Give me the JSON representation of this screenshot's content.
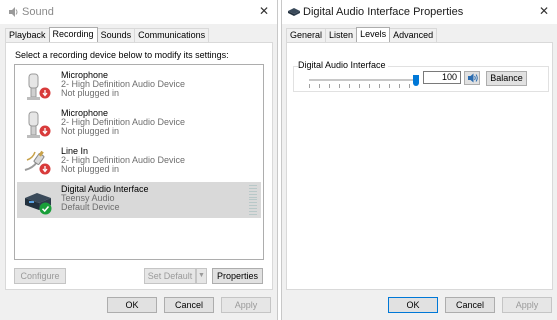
{
  "sound_window": {
    "title": "Sound",
    "tabs": [
      {
        "label": "Playback",
        "active": false
      },
      {
        "label": "Recording",
        "active": true
      },
      {
        "label": "Sounds",
        "active": false
      },
      {
        "label": "Communications",
        "active": false
      }
    ],
    "instruction": "Select a recording device below to modify its settings:",
    "devices": [
      {
        "name": "Microphone",
        "description": "2- High Definition Audio Device",
        "status": "Not plugged in",
        "icon": "microphone-icon",
        "state": "unplugged"
      },
      {
        "name": "Microphone",
        "description": "2- High Definition Audio Device",
        "status": "Not plugged in",
        "icon": "microphone-icon",
        "state": "unplugged"
      },
      {
        "name": "Line In",
        "description": "2- High Definition Audio Device",
        "status": "Not plugged in",
        "icon": "line-in-icon",
        "state": "unplugged"
      },
      {
        "name": "Digital Audio Interface",
        "description": "Teensy Audio",
        "status": "Default Device",
        "icon": "audio-interface-icon",
        "state": "default",
        "selected": true
      }
    ],
    "buttons": {
      "configure": "Configure",
      "set_default": "Set Default",
      "properties": "Properties",
      "ok": "OK",
      "cancel": "Cancel",
      "apply": "Apply"
    }
  },
  "properties_window": {
    "title": "Digital Audio Interface Properties",
    "tabs": [
      {
        "label": "General",
        "active": false
      },
      {
        "label": "Listen",
        "active": false
      },
      {
        "label": "Levels",
        "active": true
      },
      {
        "label": "Advanced",
        "active": false
      }
    ],
    "level_group_label": "Digital Audio Interface",
    "level_value": "100",
    "level_percent": 100,
    "buttons": {
      "balance": "Balance",
      "ok": "OK",
      "cancel": "Cancel",
      "apply": "Apply"
    }
  },
  "colors": {
    "accent": "#0078d7",
    "unplugged_badge": "#d83b3b",
    "default_badge": "#1a9f3a",
    "selection": "#d9d9d9"
  }
}
